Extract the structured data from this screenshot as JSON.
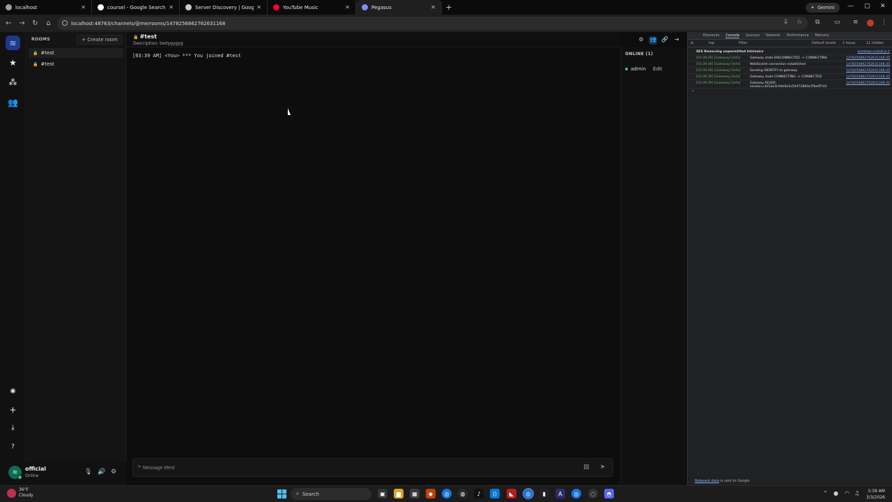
{
  "browser": {
    "tabs": [
      {
        "label": "localhost",
        "favicon_color": "#9aa0a6",
        "active": false
      },
      {
        "label": "coursel - Google Search",
        "favicon_color": "#ffffff",
        "active": false
      },
      {
        "label": "Server Discovery | Google AI St",
        "favicon_color": "#cccccc",
        "active": false
      },
      {
        "label": "YouTube Music",
        "favicon_color": "#ff0033",
        "active": false
      },
      {
        "label": "Pegasus",
        "favicon_color": "#7b8cff",
        "active": true
      }
    ],
    "gemini_label": "Gemini",
    "url": "localhost:48763/channels/@me/rooms/1478256862762631168"
  },
  "app": {
    "rail_icons": [
      "waves-logo-icon",
      "star-icon",
      "nodes-icon",
      "users-icon",
      "compass-icon",
      "plus-icon",
      "download-icon",
      "help-icon"
    ],
    "rooms": {
      "header": "ROOMS",
      "create_label": "+ Create room",
      "items": [
        {
          "label": "#test",
          "active": true
        },
        {
          "label": "#test",
          "active": false
        }
      ]
    },
    "user": {
      "name": "official",
      "status": "Online"
    },
    "channel": {
      "title": "#test",
      "description": "Description: testygygyg"
    },
    "messages": [
      {
        "text": "[03:39 AM] <You> *** You joined #test"
      }
    ],
    "composer": {
      "prompt": ">",
      "placeholder": "Message #test"
    },
    "members": {
      "title": "ONLINE (1)",
      "list": [
        {
          "name": "admin",
          "edit_label": "Edit"
        }
      ]
    }
  },
  "devtools": {
    "tabs": [
      "Elements",
      "Console",
      "Sources",
      "Network",
      "Performance",
      "Memory"
    ],
    "active_tab": "Console",
    "toolbar": {
      "context": "top",
      "filter_placeholder": "Filter",
      "levels": "Default levels",
      "issues": "1 Issue:",
      "hidden": "11 hidden"
    },
    "logs": [
      {
        "time": "",
        "msg": "SES Removing unpermitted intrinsics",
        "source": "lockdown-install.js:1"
      },
      {
        "time": "[03:39:39] [Gateway] [Info]",
        "msg": "Gateway state DISCONNECTED -> CONNECTING",
        "source": "1478256862762631168:35"
      },
      {
        "time": "[03:39:39] [Gateway] [Info]",
        "msg": "WebSocket connection established",
        "source": "1478256862762631168:35"
      },
      {
        "time": "[03:39:39] [Gateway] [Info]",
        "msg": "Sending IDENTIFY to gateway",
        "source": "1478256862762631168:35"
      },
      {
        "time": "[03:39:39] [Gateway] [Info]",
        "msg": "Gateway state CONNECTING -> CONNECTED",
        "source": "1478256862762631168:35"
      },
      {
        "time": "[03:39:39] [Gateway] [Info]",
        "msg": "Gateway READY, session=4d1aa3c0de9a1e54472864a7fbe0f7d1",
        "source": "1478256862762631168:35"
      }
    ],
    "footer_link": "Relevant data",
    "footer_text": "is sent to Google"
  },
  "taskbar": {
    "weather_temp": "36°F",
    "weather_desc": "Cloudy",
    "search_label": "Search",
    "time": "3:39 AM",
    "date": "3/3/2026"
  }
}
